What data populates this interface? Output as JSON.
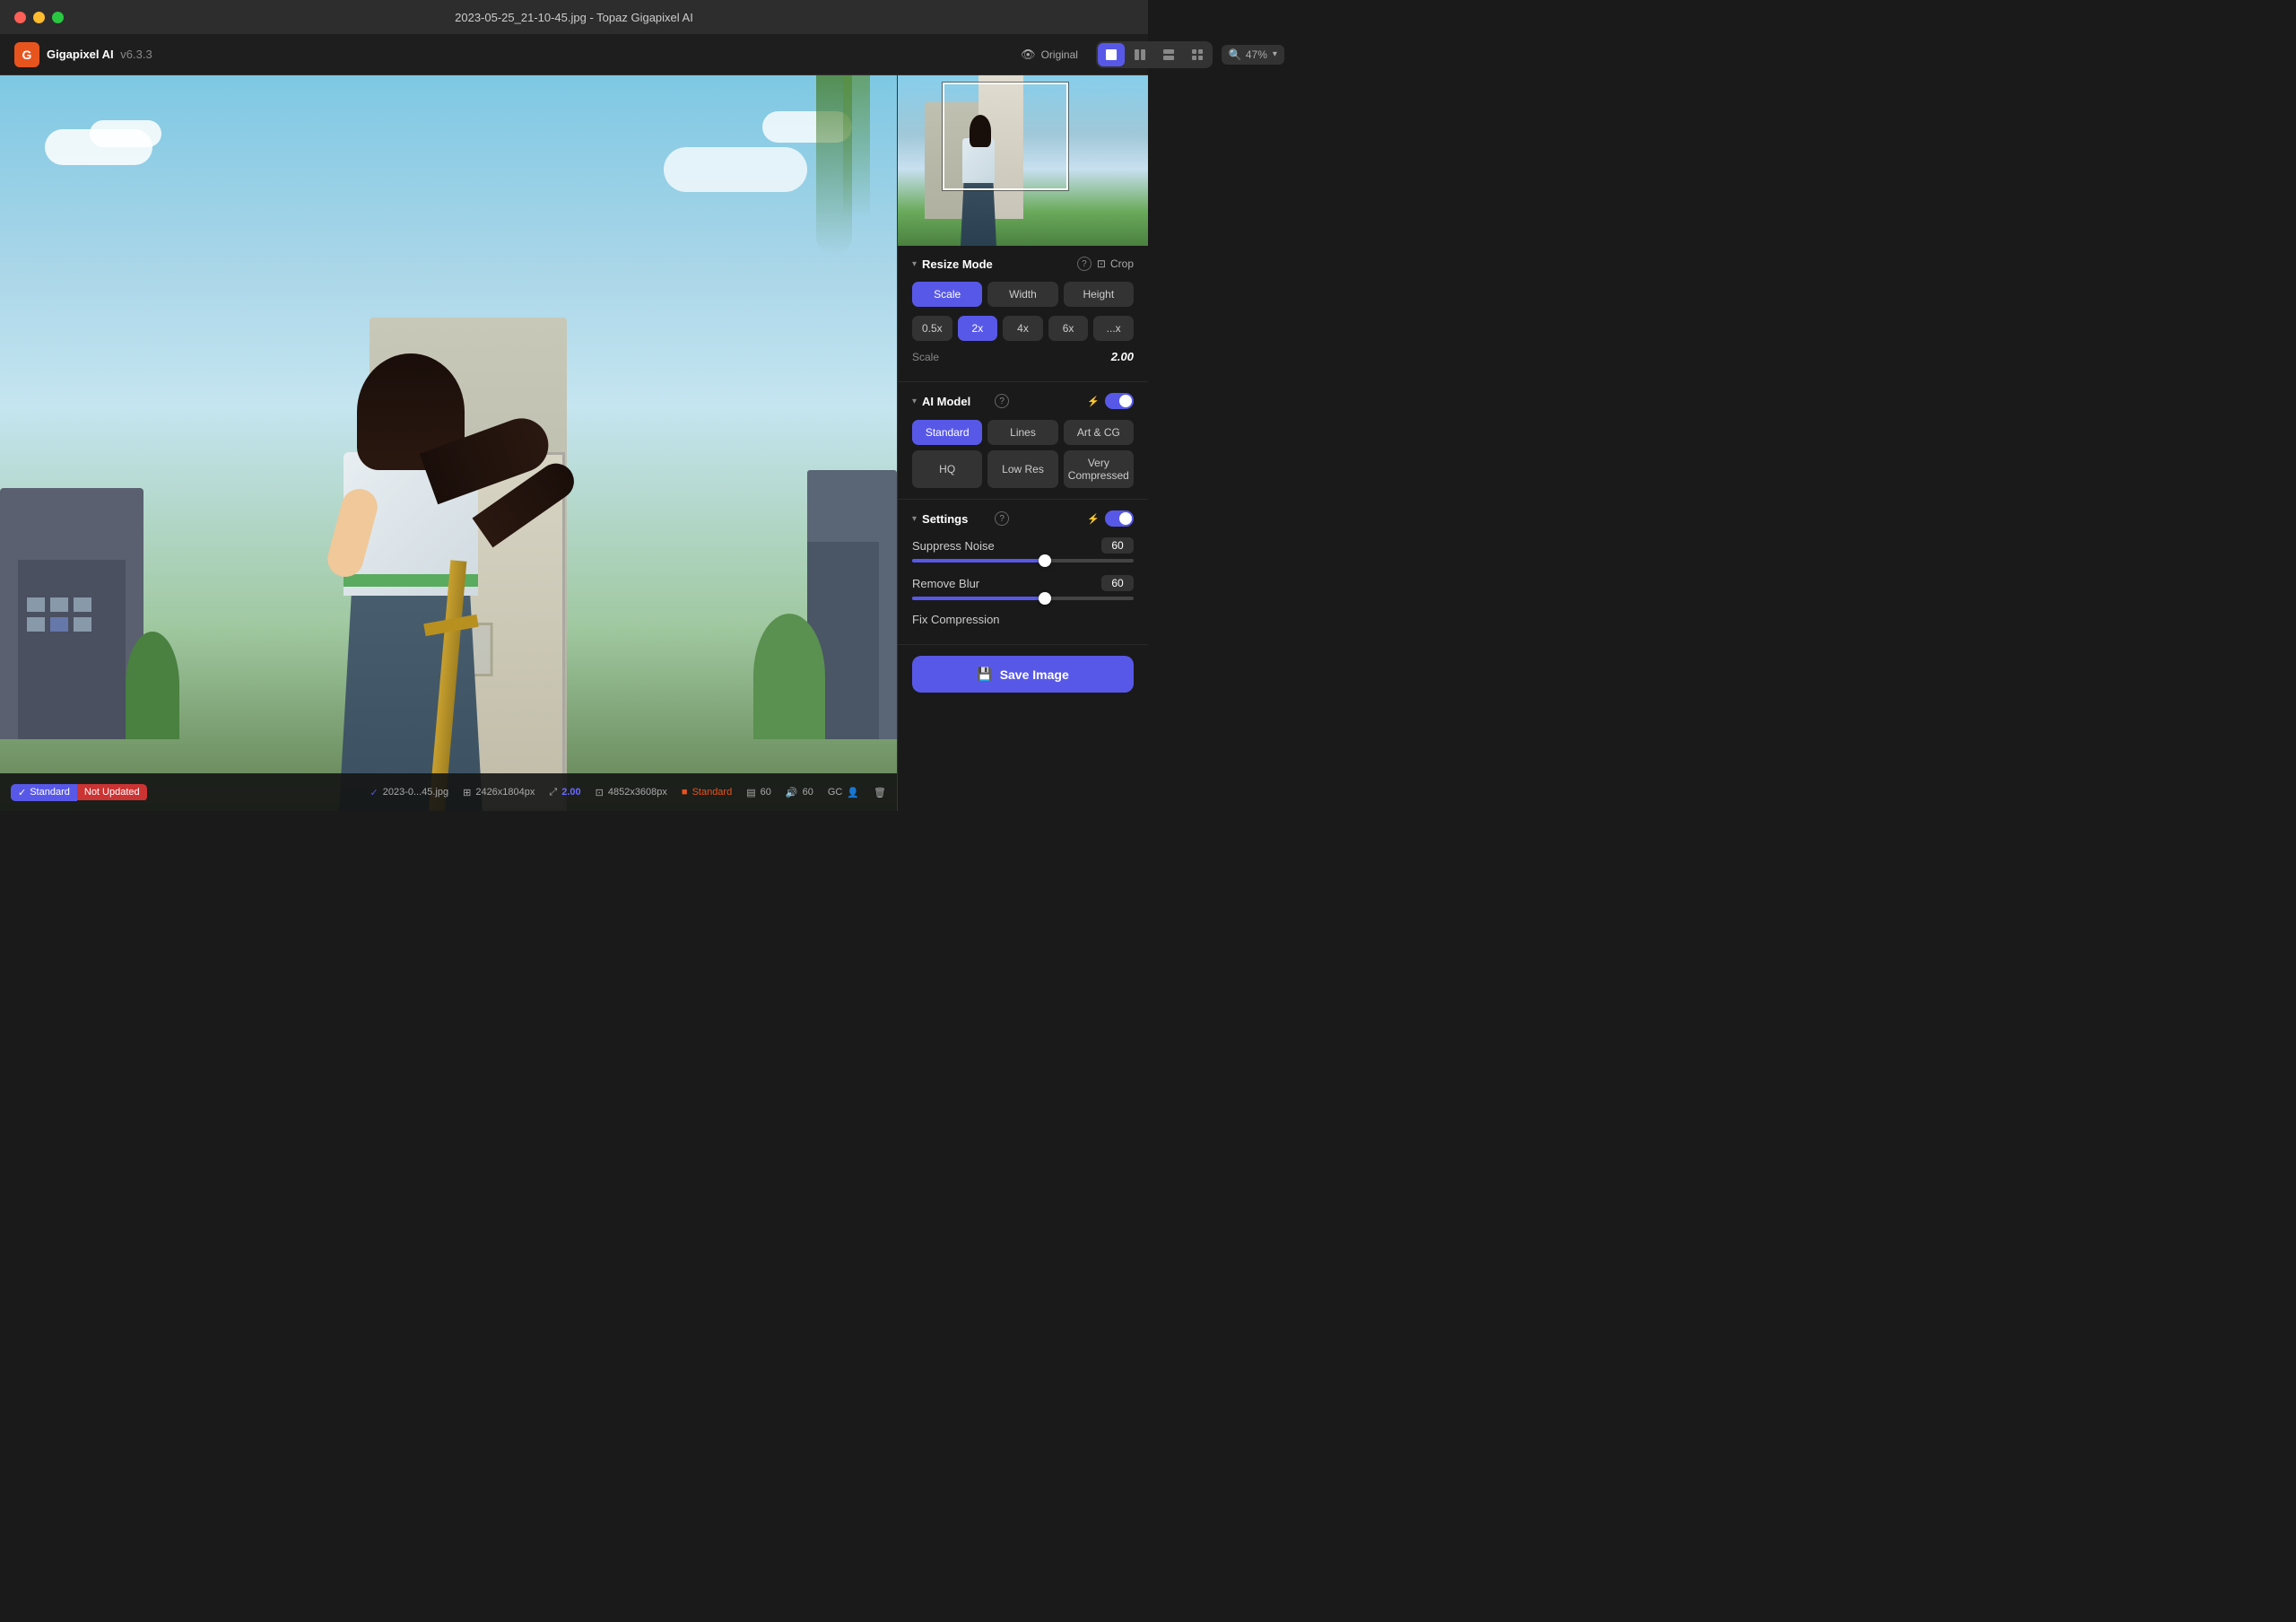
{
  "window": {
    "title": "2023-05-25_21-10-45.jpg - Topaz Gigapixel AI"
  },
  "app": {
    "name": "Gigapixel AI",
    "version": "v6.3.3"
  },
  "toolbar": {
    "original_label": "Original",
    "zoom_label": "47%",
    "view_modes": [
      "single",
      "split-v",
      "split-h",
      "quad"
    ]
  },
  "resize_mode": {
    "title": "Resize Mode",
    "crop_label": "Crop",
    "scale_btn": "Scale",
    "width_btn": "Width",
    "height_btn": "Height",
    "scale_options": [
      "0.5x",
      "2x",
      "4x",
      "6x",
      "...x"
    ],
    "active_scale": "2x",
    "scale_value_label": "Scale",
    "scale_value": "2.00"
  },
  "ai_model": {
    "title": "AI Model",
    "options_row1": [
      "Standard",
      "Lines",
      "Art & CG"
    ],
    "options_row2": [
      "HQ",
      "Low Res",
      "Very Compressed"
    ],
    "active": "Standard"
  },
  "settings": {
    "title": "Settings",
    "suppress_noise_label": "Suppress Noise",
    "suppress_noise_value": "60",
    "suppress_noise_pct": 60,
    "remove_blur_label": "Remove Blur",
    "remove_blur_value": "60",
    "remove_blur_pct": 60,
    "fix_compression_label": "Fix Compression"
  },
  "bottom_bar": {
    "check_icon": "✓",
    "filename": "2023-0...45.jpg",
    "badge_standard": "Standard",
    "badge_not_updated": "Not Updated",
    "original_size_icon": "⊞",
    "original_size": "2426x1804px",
    "scale_icon": "⤢",
    "scale_factor": "2.00",
    "output_size": "4852x3608px",
    "model_icon": "🎨",
    "model_label": "Standard",
    "noise_icon": "▤",
    "noise_value": "60",
    "blur_icon": "🔊",
    "blur_value": "60",
    "gc_label": "GC",
    "delete_icon": "🗑"
  },
  "save": {
    "button_label": "Save Image"
  },
  "icons": {
    "chevron_down": "›",
    "help": "?",
    "crop": "⊡",
    "lightning": "⚡",
    "save": "💾",
    "eye": "👁",
    "smile": "🙂",
    "face": "😐"
  }
}
